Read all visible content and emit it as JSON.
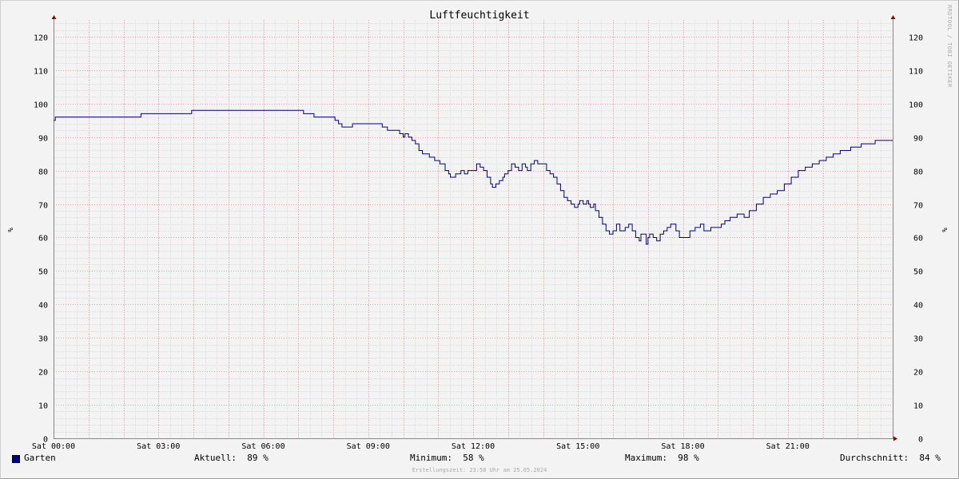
{
  "chart_data": {
    "type": "line",
    "title": "Luftfeuchtigkeit",
    "ylabel_left": "%",
    "ylabel_right": "%",
    "ylim": [
      0,
      125
    ],
    "y_ticks": [
      0,
      10,
      20,
      30,
      40,
      50,
      60,
      70,
      80,
      90,
      100,
      110,
      120
    ],
    "x_range_hours": [
      0,
      24
    ],
    "x_ticks": [
      {
        "h": 0,
        "label": "Sat 00:00"
      },
      {
        "h": 3,
        "label": "Sat 03:00"
      },
      {
        "h": 6,
        "label": "Sat 06:00"
      },
      {
        "h": 9,
        "label": "Sat 09:00"
      },
      {
        "h": 12,
        "label": "Sat 12:00"
      },
      {
        "h": 15,
        "label": "Sat 15:00"
      },
      {
        "h": 18,
        "label": "Sat 18:00"
      },
      {
        "h": 21,
        "label": "Sat 21:00"
      }
    ],
    "grid": true,
    "series": [
      {
        "name": "Garten",
        "color": "#00008b",
        "x": [
          0,
          0.05,
          0.1,
          2.45,
          2.5,
          3.9,
          3.95,
          7.1,
          7.15,
          7.4,
          7.45,
          8.0,
          8.05,
          8.15,
          8.25,
          8.35,
          8.55,
          8.65,
          8.75,
          9.3,
          9.4,
          9.55,
          9.8,
          9.9,
          10.0,
          10.05,
          10.15,
          10.25,
          10.35,
          10.45,
          10.55,
          10.65,
          10.75,
          10.9,
          11.05,
          11.2,
          11.3,
          11.35,
          11.5,
          11.65,
          11.75,
          11.85,
          12.1,
          12.2,
          12.3,
          12.4,
          12.5,
          12.55,
          12.65,
          12.75,
          12.85,
          12.9,
          13.0,
          13.1,
          13.2,
          13.3,
          13.4,
          13.5,
          13.55,
          13.65,
          13.75,
          13.85,
          14.1,
          14.2,
          14.3,
          14.4,
          14.5,
          14.6,
          14.7,
          14.8,
          14.9,
          15.0,
          15.05,
          15.15,
          15.25,
          15.3,
          15.35,
          15.45,
          15.5,
          15.6,
          15.7,
          15.8,
          15.9,
          16.0,
          16.1,
          16.2,
          16.35,
          16.45,
          16.55,
          16.65,
          16.75,
          16.8,
          16.95,
          17.0,
          17.05,
          17.15,
          17.25,
          17.35,
          17.45,
          17.55,
          17.65,
          17.8,
          17.9,
          18.0,
          18.1,
          18.2,
          18.35,
          18.5,
          18.6,
          18.7,
          18.8,
          18.95,
          19.1,
          19.2,
          19.35,
          19.55,
          19.75,
          19.9,
          20.1,
          20.3,
          20.5,
          20.7,
          20.9,
          21.1,
          21.3,
          21.5,
          21.7,
          21.9,
          22.1,
          22.3,
          22.5,
          22.8,
          23.1,
          23.4,
          23.5,
          23.9,
          24.0
        ],
        "values": [
          95,
          96,
          96,
          96,
          97,
          97,
          98,
          98,
          97,
          97,
          96,
          96,
          95,
          94,
          93,
          93,
          94,
          94,
          94,
          94,
          93,
          92,
          92,
          91,
          90,
          91,
          90,
          89,
          88,
          86,
          85,
          85,
          84,
          83,
          82,
          80,
          79,
          78,
          79,
          80,
          79,
          80,
          82,
          81,
          80,
          78,
          76,
          75,
          76,
          77,
          78,
          79,
          80,
          82,
          81,
          80,
          82,
          81,
          80,
          82,
          83,
          82,
          80,
          79,
          78,
          76,
          74,
          72,
          71,
          70,
          69,
          70,
          71,
          70,
          71,
          70,
          69,
          70,
          68,
          66,
          64,
          62,
          61,
          62,
          64,
          62,
          63,
          64,
          62,
          60,
          59,
          61,
          58,
          60,
          61,
          60,
          59,
          61,
          62,
          63,
          64,
          62,
          60,
          60,
          60,
          62,
          63,
          64,
          62,
          62,
          63,
          63,
          64,
          65,
          66,
          67,
          66,
          68,
          70,
          72,
          73,
          74,
          76,
          78,
          80,
          81,
          82,
          83,
          84,
          85,
          86,
          87,
          88,
          88,
          89,
          89,
          89
        ]
      }
    ]
  },
  "legend": {
    "series_name": "Garten",
    "current": "Aktuell:  89 %",
    "minimum": "Minimum:  58 %",
    "maximum": "Maximum:  98 %",
    "average": "Durchschnitt:  84 %"
  },
  "footnote": "Erstellungszeit: 23:58 Uhr am 25.05.2024",
  "watermark": "RRDTOOL / TOBI OETIKER"
}
